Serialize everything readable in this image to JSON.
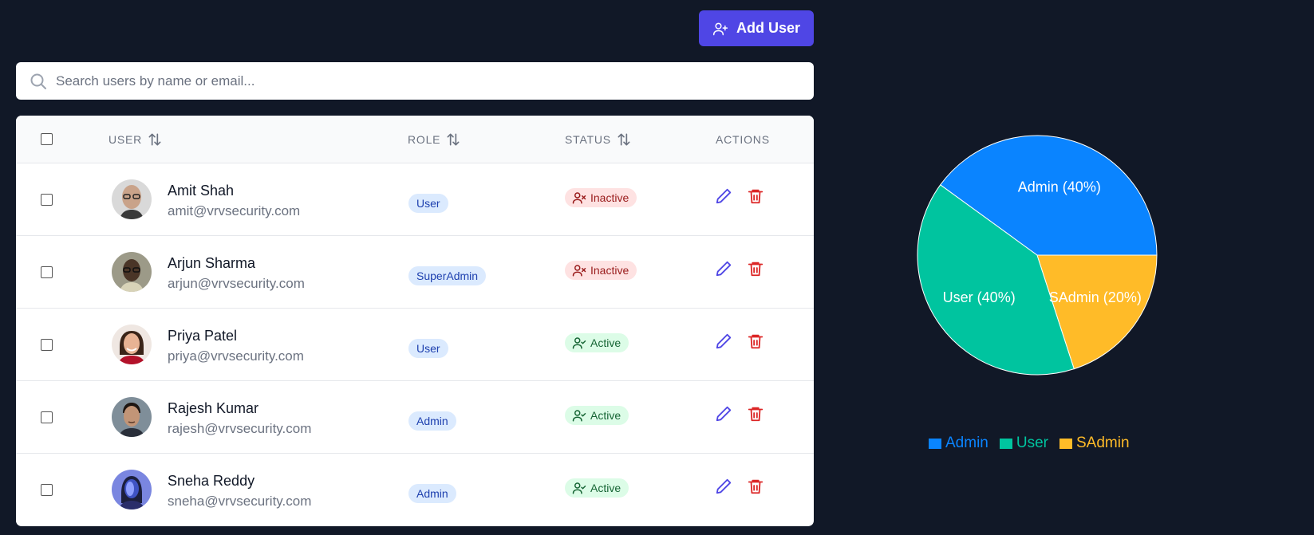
{
  "toolbar": {
    "add_user_label": "Add User"
  },
  "search": {
    "placeholder": "Search users by name or email..."
  },
  "table": {
    "headers": {
      "user": "USER",
      "role": "ROLE",
      "status": "STATUS",
      "actions": "ACTIONS"
    },
    "rows": [
      {
        "name": "Amit Shah",
        "email": "amit@vrvsecurity.com",
        "role": "User",
        "status": "Inactive"
      },
      {
        "name": "Arjun Sharma",
        "email": "arjun@vrvsecurity.com",
        "role": "SuperAdmin",
        "status": "Inactive"
      },
      {
        "name": "Priya Patel",
        "email": "priya@vrvsecurity.com",
        "role": "User",
        "status": "Active"
      },
      {
        "name": "Rajesh Kumar",
        "email": "rajesh@vrvsecurity.com",
        "role": "Admin",
        "status": "Active"
      },
      {
        "name": "Sneha Reddy",
        "email": "sneha@vrvsecurity.com",
        "role": "Admin",
        "status": "Active"
      }
    ]
  },
  "colors": {
    "accent": "#4f46e5",
    "admin": "#0a84ff",
    "user": "#00c49f",
    "sadmin": "#ffbb28"
  },
  "chart_data": {
    "type": "pie",
    "categories": [
      "Admin",
      "User",
      "SAdmin"
    ],
    "values": [
      40,
      40,
      20
    ],
    "labels": [
      "Admin (40%)",
      "User (40%)",
      "SAdmin (20%)"
    ],
    "colors": [
      "#0a84ff",
      "#00c49f",
      "#ffbb28"
    ],
    "legend": [
      "Admin",
      "User",
      "SAdmin"
    ],
    "legend_position": "bottom"
  }
}
